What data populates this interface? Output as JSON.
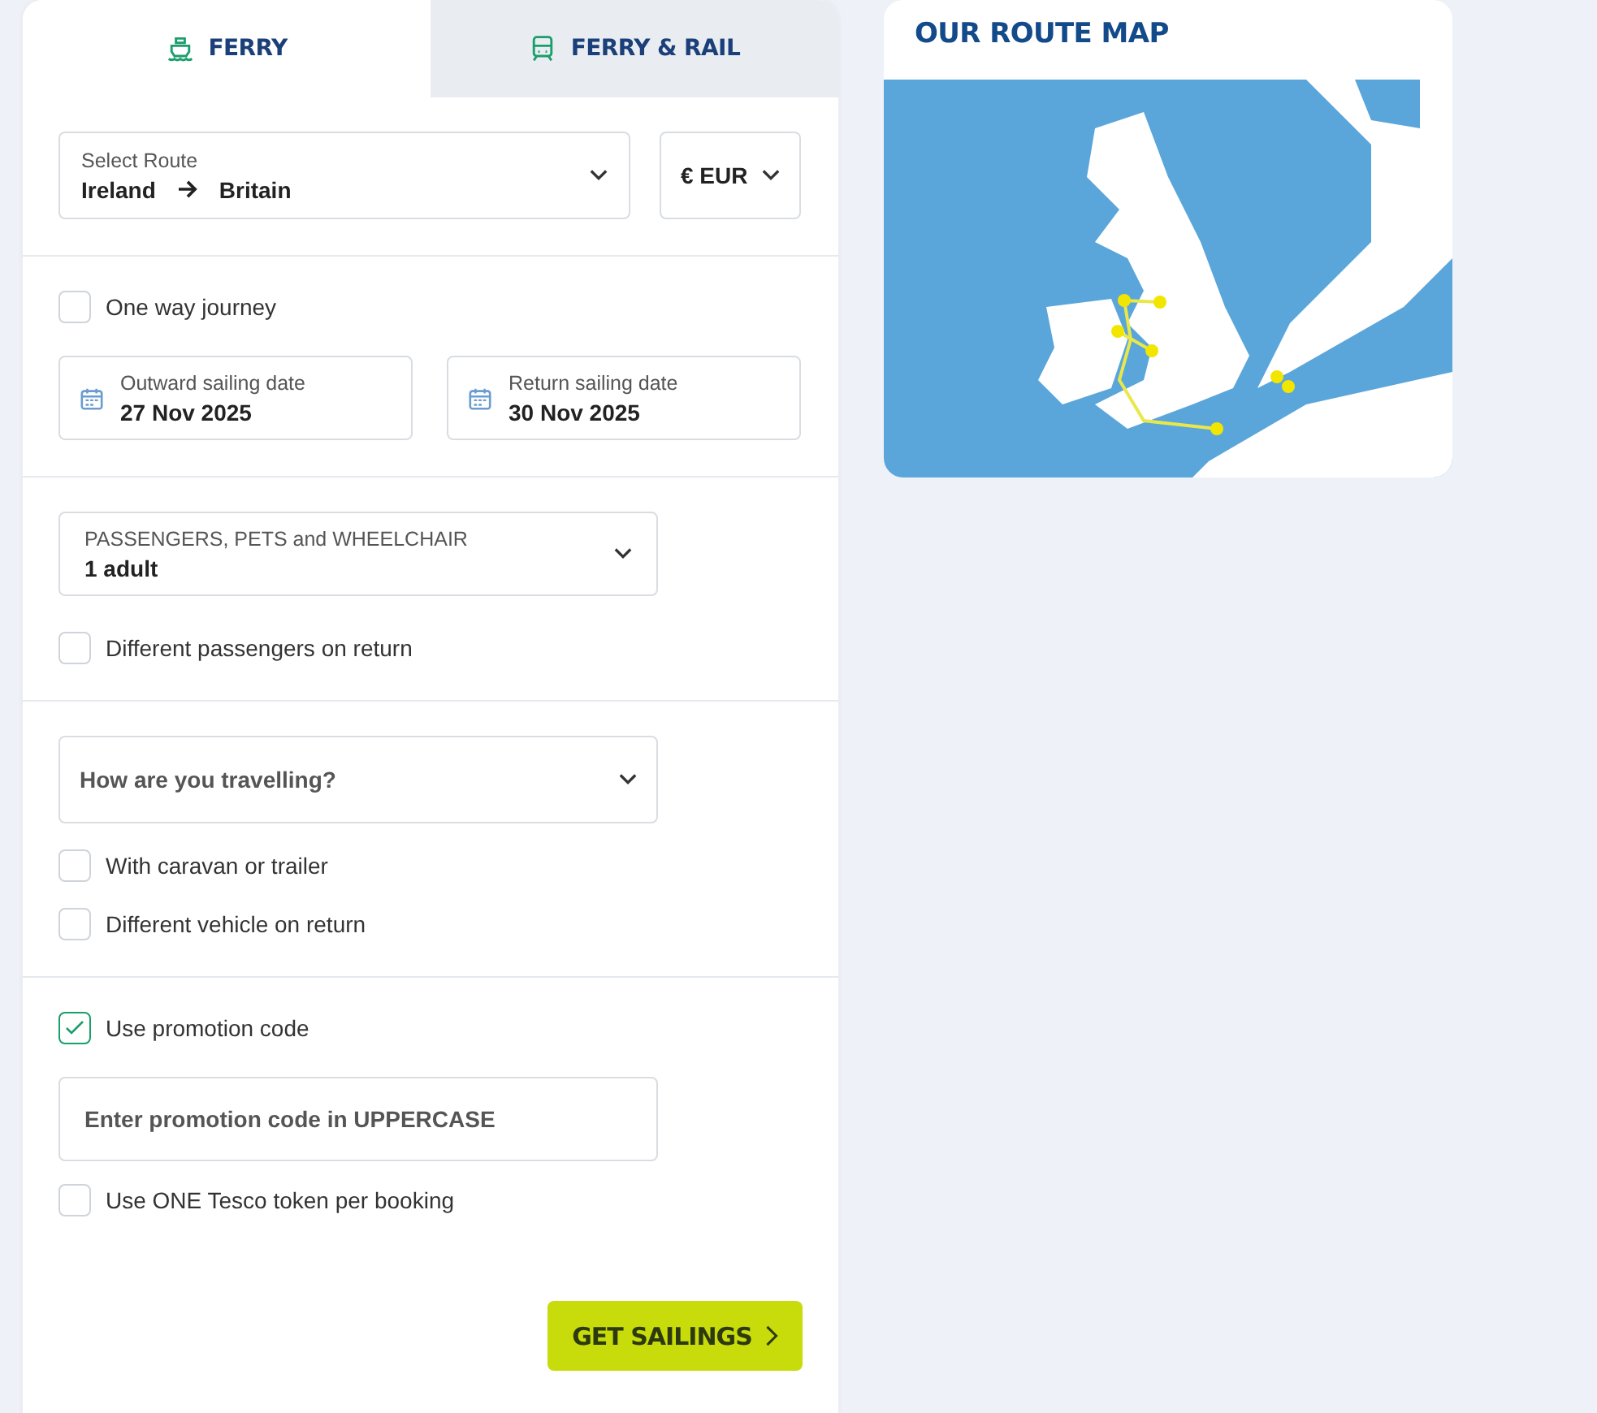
{
  "tabs": [
    {
      "label": "FERRY",
      "kind": "ship",
      "selected": true
    },
    {
      "label": "FERRY & RAIL",
      "kind": "train",
      "selected": false
    }
  ],
  "route": {
    "label": "Select Route",
    "from": "Ireland",
    "to": "Britain"
  },
  "currency": {
    "value": "€ EUR"
  },
  "one_way": {
    "label": "One way journey",
    "checked": false
  },
  "dates": [
    {
      "label": "Outward sailing date",
      "value": "27 Nov 2025"
    },
    {
      "label": "Return sailing date",
      "value": "30 Nov 2025"
    }
  ],
  "passengers": {
    "label": "PASSENGERS, PETS and WHEELCHAIR",
    "value": "1 adult"
  },
  "different_passengers": {
    "label": "Different passengers on return",
    "checked": false
  },
  "travel": {
    "placeholder": "How are you travelling?"
  },
  "vehicle_options": [
    {
      "label": "With caravan or trailer",
      "checked": false
    },
    {
      "label": "Different vehicle on return",
      "checked": false
    }
  ],
  "promo": {
    "label": "Use promotion code",
    "checked": true,
    "placeholder": "Enter promotion code in UPPERCASE"
  },
  "tesco": {
    "label": "Use ONE Tesco token per booking",
    "checked": false
  },
  "submit": {
    "label": "GET SAILINGS"
  },
  "route_map": {
    "title": "OUR ROUTE MAP"
  }
}
